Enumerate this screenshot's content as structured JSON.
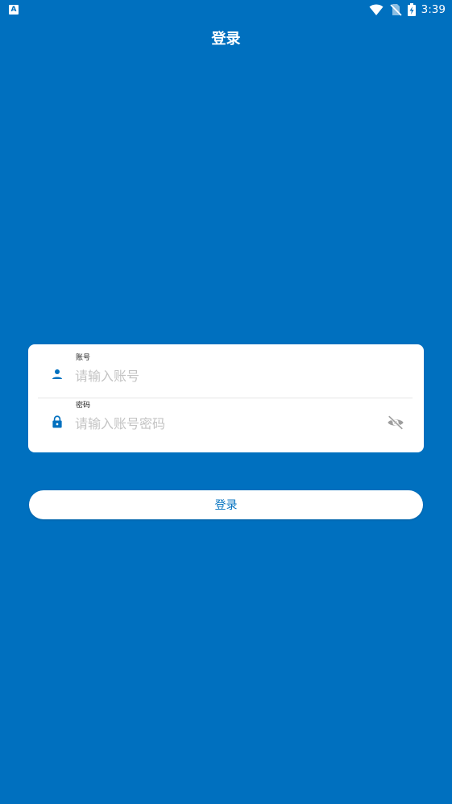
{
  "status_bar": {
    "app_icon_letter": "A",
    "time": "3:39",
    "icons": [
      "wifi-icon",
      "no-sim-icon",
      "battery-charging-icon"
    ]
  },
  "header": {
    "title": "登录"
  },
  "form": {
    "account": {
      "label": "账号",
      "placeholder": "请输入账号",
      "value": "",
      "icon": "person-icon"
    },
    "password": {
      "label": "密码",
      "placeholder": "请输入账号密码",
      "value": "",
      "icon": "lock-icon",
      "toggle_icon": "eye-off-icon"
    }
  },
  "login_button": {
    "label": "登录"
  },
  "colors": {
    "background": "#0070bf",
    "card": "#ffffff",
    "accent": "#0070bf",
    "placeholder": "#c4c4c4",
    "toggle_icon": "#9e9e9e"
  }
}
